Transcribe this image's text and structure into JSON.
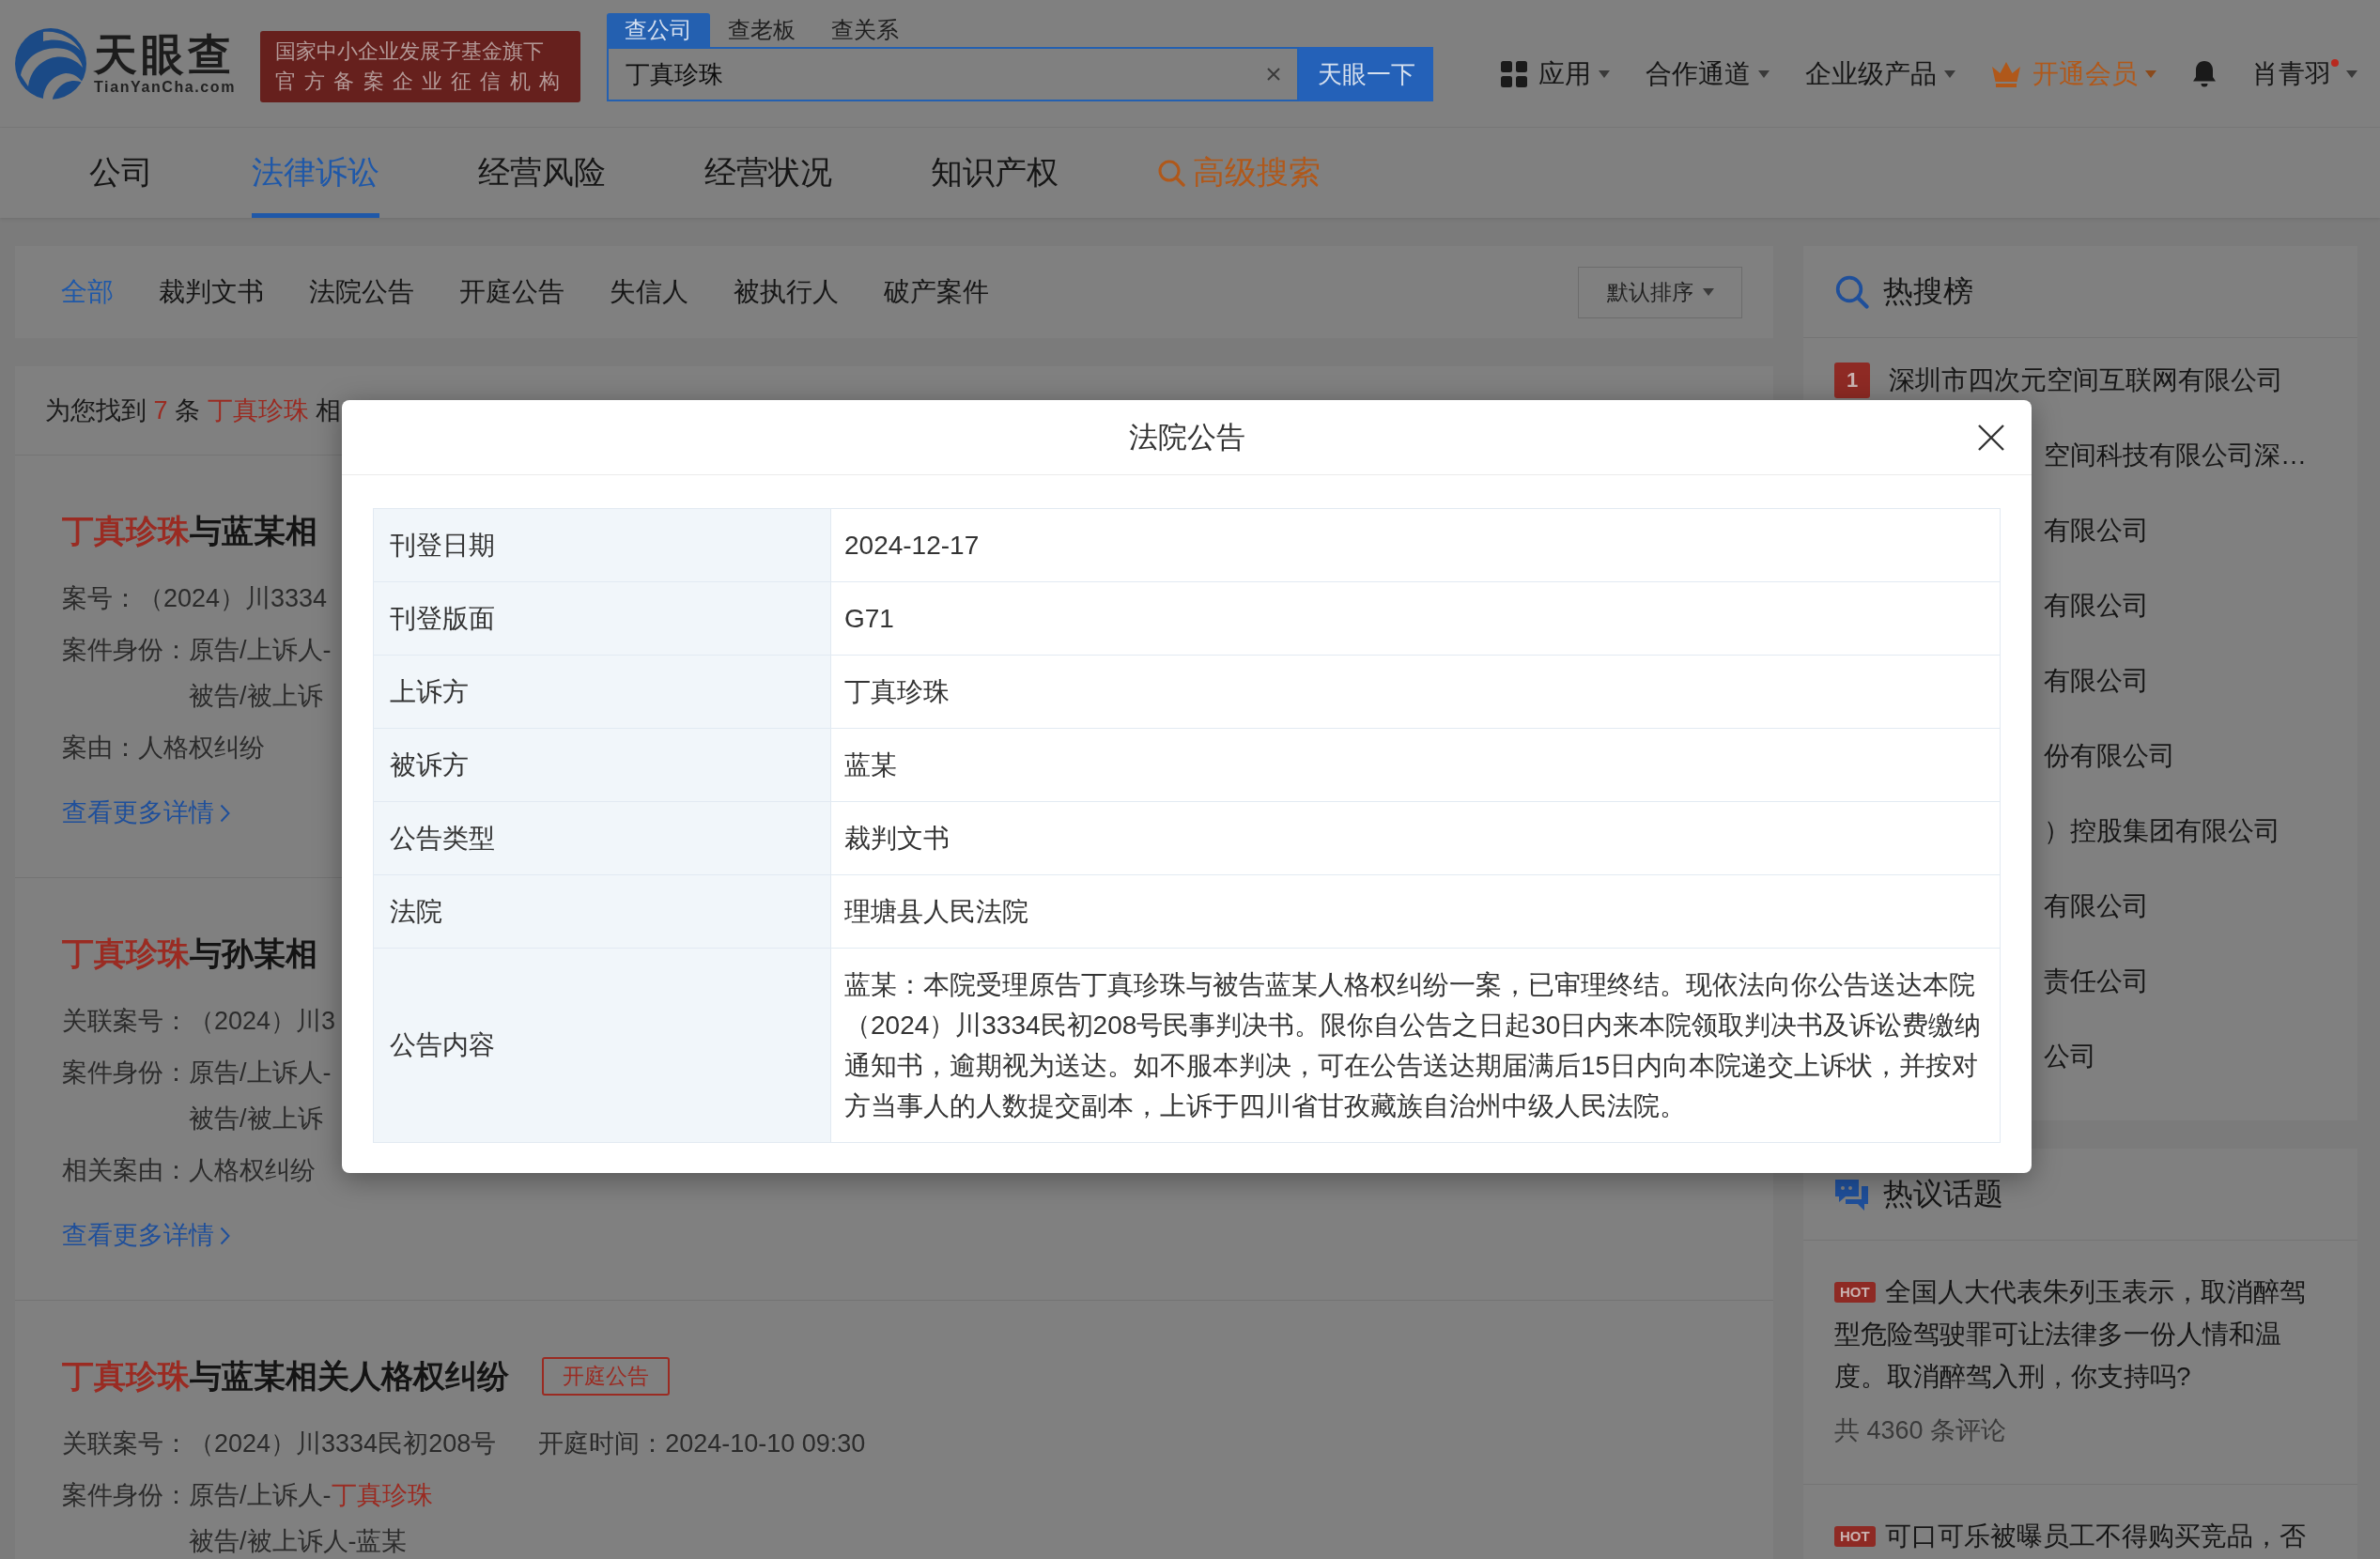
{
  "header": {
    "logo": {
      "name": "天眼查",
      "domain": "TianYanCha.com"
    },
    "banner": [
      "国家中小企业发展子基金旗下",
      "官方备案企业征信机构"
    ],
    "search": {
      "tabs": [
        {
          "label": "查公司",
          "selected": true
        },
        {
          "label": "查老板",
          "selected": false
        },
        {
          "label": "查关系",
          "selected": false
        }
      ],
      "value": "丁真珍珠",
      "button": "天眼一下"
    },
    "nav": [
      {
        "kind": "apps",
        "label": "应用"
      },
      {
        "kind": "menu",
        "label": "合作通道"
      },
      {
        "kind": "menu",
        "label": "企业级产品"
      },
      {
        "kind": "vip",
        "label": "开通会员"
      },
      {
        "kind": "bell"
      },
      {
        "kind": "user",
        "label": "肖青羽",
        "unread": true
      }
    ]
  },
  "main_tabs": [
    {
      "kind": "tab",
      "label": "公司",
      "selected": false
    },
    {
      "kind": "tab",
      "label": "法律诉讼",
      "selected": true
    },
    {
      "kind": "tab",
      "label": "经营风险",
      "selected": false
    },
    {
      "kind": "tab",
      "label": "经营状况",
      "selected": false
    },
    {
      "kind": "tab",
      "label": "知识产权",
      "selected": false
    },
    {
      "kind": "search",
      "label": "高级搜索",
      "selected": false
    }
  ],
  "filter": {
    "tabs": [
      {
        "label": "全部",
        "selected": true
      },
      {
        "label": "裁判文书",
        "selected": false
      },
      {
        "label": "法院公告",
        "selected": false
      },
      {
        "label": "开庭公告",
        "selected": false
      },
      {
        "label": "失信人",
        "selected": false
      },
      {
        "label": "被执行人",
        "selected": false
      },
      {
        "label": "破产案件",
        "selected": false
      }
    ],
    "sort": "默认排序"
  },
  "results": {
    "summary": [
      {
        "text": "为您找到 "
      },
      {
        "highlight": "7"
      },
      {
        "text": " 条 "
      },
      {
        "highlight": "丁真珍珠"
      },
      {
        "text": " 相"
      }
    ],
    "items": [
      {
        "title": [
          {
            "highlight": "丁真珍珠"
          },
          {
            "text": "与蓝某相"
          }
        ],
        "rows": [
          [
            {
              "label": "案号：",
              "lines": [
                [
                  {
                    "text": "（2024）川3334"
                  }
                ]
              ]
            }
          ],
          [
            {
              "label": "案件身份：",
              "lines": [
                [
                  {
                    "text": "原告/上诉人-"
                  }
                ],
                [
                  {
                    "text": "被告/被上诉"
                  }
                ]
              ]
            }
          ],
          [
            {
              "label": "案由：",
              "lines": [
                [
                  {
                    "text": "人格权纠纷"
                  }
                ]
              ]
            }
          ]
        ],
        "link": "查看更多详情"
      },
      {
        "title": [
          {
            "highlight": "丁真珍珠"
          },
          {
            "text": "与孙某相"
          }
        ],
        "rows": [
          [
            {
              "label": "关联案号：",
              "lines": [
                [
                  {
                    "text": "（2024）川3"
                  }
                ]
              ]
            }
          ],
          [
            {
              "label": "案件身份：",
              "lines": [
                [
                  {
                    "text": "原告/上诉人-"
                  }
                ],
                [
                  {
                    "text": "被告/被上诉"
                  }
                ]
              ]
            }
          ],
          [
            {
              "label": "相关案由：",
              "lines": [
                [
                  {
                    "text": "人格权纠纷"
                  }
                ]
              ]
            }
          ]
        ],
        "link": "查看更多详情"
      },
      {
        "title": [
          {
            "highlight": "丁真珍珠"
          },
          {
            "text": "与蓝某相关人格权纠纷"
          }
        ],
        "tag": "开庭公告",
        "rows": [
          [
            {
              "label": "关联案号：",
              "lines": [
                [
                  {
                    "text": "（2024）川3334民初208号"
                  }
                ]
              ]
            },
            {
              "label": "开庭时间：",
              "lines": [
                [
                  {
                    "text": "2024-10-10 09:30"
                  }
                ]
              ]
            }
          ],
          [
            {
              "label": "案件身份：",
              "lines": [
                [
                  {
                    "text": "原告/上诉人-"
                  },
                  {
                    "highlight": "丁真珍珠"
                  }
                ],
                [
                  {
                    "text": "被告/被上诉人-蓝某"
                  }
                ]
              ]
            }
          ]
        ]
      }
    ]
  },
  "sidebar": {
    "hot_search": {
      "title": "热搜榜",
      "items": [
        {
          "rank": "1",
          "text": "深圳市四次元空间互联网有限公司"
        },
        {
          "text": "空间科技有限公司深…"
        },
        {
          "text": "有限公司"
        },
        {
          "text": "有限公司"
        },
        {
          "text": "有限公司"
        },
        {
          "text": "份有限公司"
        },
        {
          "text": "）控股集团有限公司"
        },
        {
          "text": "有限公司"
        },
        {
          "text": "责任公司"
        },
        {
          "text": "公司"
        }
      ]
    },
    "hot_topics": {
      "title": "热议话题",
      "items": [
        {
          "badge": "HOT",
          "text": "全国人大代表朱列玉表示，取消醉驾型危险驾驶罪可让法律多一份人情和温度。取消醉驾入刑，你支持吗?",
          "comments": "共 4360 条评论"
        },
        {
          "badge": "HOT",
          "text": "可口可乐被曝员工不得购买竞品，否"
        }
      ]
    }
  },
  "dialog": {
    "title": "法院公告",
    "rows": [
      {
        "label": "刊登日期",
        "value": "2024-12-17"
      },
      {
        "label": "刊登版面",
        "value": "G71"
      },
      {
        "label": "上诉方",
        "value": "丁真珍珠"
      },
      {
        "label": "被诉方",
        "value": "蓝某"
      },
      {
        "label": "公告类型",
        "value": "裁判文书"
      },
      {
        "label": "法院",
        "value": "理塘县人民法院"
      },
      {
        "label": "公告内容",
        "value": "蓝某：本院受理原告丁真珍珠与被告蓝某人格权纠纷一案，已审理终结。现依法向你公告送达本院（2024）川3334民初208号民事判决书。限你自公告之日起30日内来本院领取判决书及诉讼费缴纳通知书，逾期视为送达。如不服本判决，可在公告送达期届满后15日内向本院递交上诉状，并按对方当事人的人数提交副本，上诉于四川省甘孜藏族自治州中级人民法院。"
      }
    ]
  }
}
